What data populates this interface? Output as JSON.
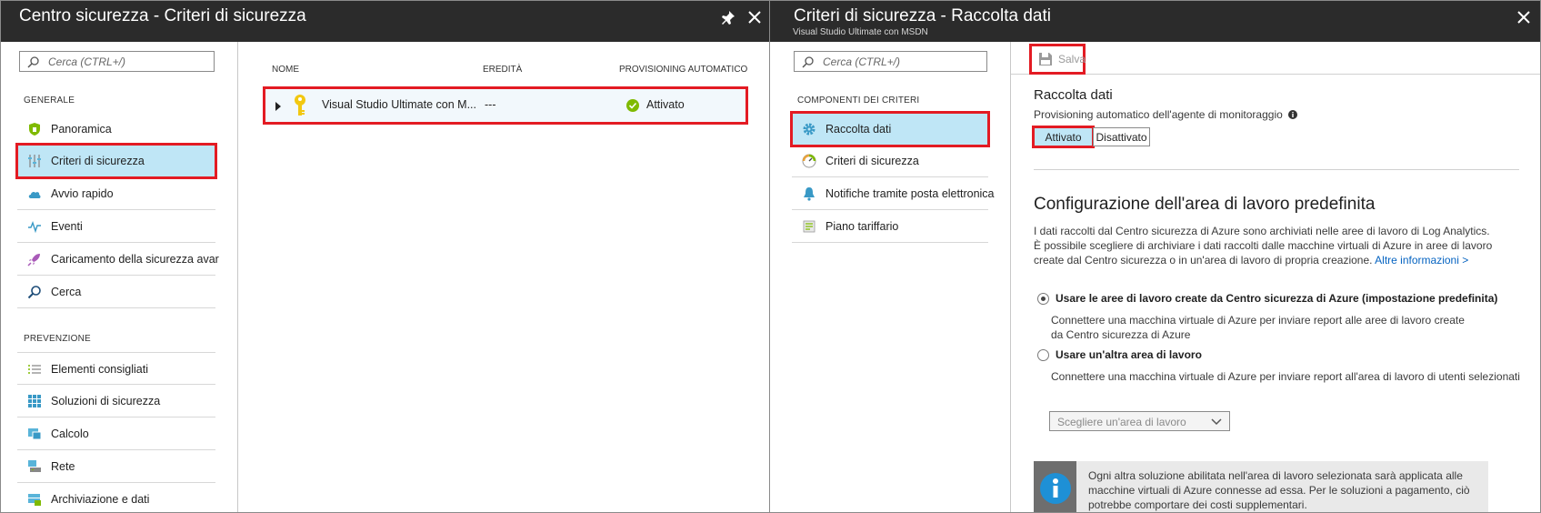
{
  "blade1": {
    "title": "Centro sicurezza - Criteri di sicurezza",
    "search_placeholder": "Cerca (CTRL+/)",
    "sections": [
      {
        "label": "GENERALE",
        "items": [
          {
            "label": "Panoramica",
            "icon": "shield-icon"
          },
          {
            "label": "Criteri di sicurezza",
            "icon": "sliders-icon"
          },
          {
            "label": "Avvio rapido",
            "icon": "cloud-icon"
          },
          {
            "label": "Eventi",
            "icon": "pulse-icon"
          },
          {
            "label": "Caricamento della sicurezza avar",
            "icon": "rocket-icon"
          },
          {
            "label": "Cerca",
            "icon": "search-icon"
          }
        ]
      },
      {
        "label": "PREVENZIONE",
        "items": [
          {
            "label": "Elementi consigliati",
            "icon": "list-icon"
          },
          {
            "label": "Soluzioni di sicurezza",
            "icon": "grid-icon"
          },
          {
            "label": "Calcolo",
            "icon": "compute-icon"
          },
          {
            "label": "Rete",
            "icon": "network-icon"
          },
          {
            "label": "Archiviazione e dati",
            "icon": "storage-icon"
          }
        ]
      }
    ],
    "grid": {
      "columns": [
        "NOME",
        "EREDITÀ",
        "PROVISIONING AUTOMATICO"
      ],
      "rows": [
        {
          "name": "Visual Studio Ultimate con M...",
          "inherit": "---",
          "status": "Attivato"
        }
      ]
    }
  },
  "blade2": {
    "title": "Criteri di sicurezza - Raccolta dati",
    "subtitle": "Visual Studio Ultimate con MSDN",
    "search_placeholder": "Cerca (CTRL+/)",
    "menu_section": "COMPONENTI DEI CRITERI",
    "menu_items": [
      {
        "label": "Raccolta dati",
        "icon": "gear-icon"
      },
      {
        "label": "Criteri di sicurezza",
        "icon": "gauge-icon"
      },
      {
        "label": "Notifiche tramite posta elettronica",
        "icon": "bell-icon"
      },
      {
        "label": "Piano tariffario",
        "icon": "pricing-icon"
      }
    ],
    "toolbar": {
      "save_label": "Salva"
    },
    "data_collection": {
      "heading": "Raccolta dati",
      "provisioning_label": "Provisioning automatico dell'agente di monitoraggio",
      "toggle_on": "Attivato",
      "toggle_off": "Disattivato"
    },
    "workspace": {
      "heading": "Configurazione dell'area di lavoro predefinita",
      "desc_line1": "I dati raccolti dal Centro sicurezza di Azure sono archiviati nelle aree di lavoro di Log Analytics.",
      "desc_line2": "È possibile scegliere di archiviare i dati raccolti dalle macchine virtuali di Azure in aree di lavoro",
      "desc_line3": "create dal Centro sicurezza o in un'area di lavoro di propria creazione.",
      "more_link": "Altre informazioni >",
      "option1_label": "Usare le aree di lavoro create da Centro sicurezza di Azure (impostazione predefinita)",
      "option1_desc": "Connettere una macchina virtuale di Azure per inviare report alle aree di lavoro create da Centro sicurezza di Azure",
      "option2_label": "Usare un'altra area di lavoro",
      "option2_desc": "Connettere una macchina virtuale di Azure per inviare report all'area di lavoro di utenti selezionati",
      "select_placeholder": "Scegliere un'area di lavoro",
      "info_text": "Ogni altra soluzione abilitata nell'area di lavoro selezionata sarà applicata alle macchine virtuali di Azure connesse ad essa. Per le soluzioni a pagamento, ciò potrebbe comportare dei costi supplementari."
    }
  },
  "colors": {
    "accent_selected": "#bfe6f6",
    "highlight_red": "#e31b23",
    "title_bar": "#2b2b2b"
  }
}
